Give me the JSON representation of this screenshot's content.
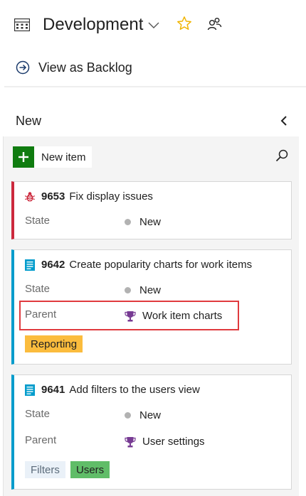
{
  "header": {
    "board_icon": "board-grid-icon",
    "title": "Development",
    "dropdown_icon": "chevron-down-icon",
    "favorite_icon": "star-icon",
    "team_icon": "people-icon"
  },
  "nav": {
    "backlog_icon": "arrow-circle-right-icon",
    "backlog_label": "View as Backlog"
  },
  "column": {
    "title": "New",
    "collapse_icon": "chevron-left-icon",
    "new_item_label": "New item",
    "search_icon": "search-icon"
  },
  "cards": [
    {
      "type": "bug",
      "icon": "bug-icon",
      "id": "9653",
      "title": "Fix display issues",
      "fields": [
        {
          "label": "State",
          "value": "New"
        }
      ],
      "tags": []
    },
    {
      "type": "product-backlog-item",
      "icon": "backlog-item-icon",
      "id": "9642",
      "title": "Create popularity charts for work items",
      "fields": [
        {
          "label": "State",
          "value": "New"
        },
        {
          "label": "Parent",
          "value": "Work item charts"
        }
      ],
      "tags": [
        "Reporting"
      ]
    },
    {
      "type": "product-backlog-item",
      "icon": "backlog-item-icon",
      "id": "9641",
      "title": "Add filters to the users view",
      "fields": [
        {
          "label": "State",
          "value": "New"
        },
        {
          "label": "Parent",
          "value": "User settings"
        }
      ],
      "tags": [
        "Filters",
        "Users"
      ]
    }
  ],
  "colors": {
    "accent_blue": "#009ccc",
    "bug_red": "#cc293d",
    "add_green": "#107c10",
    "highlight_red": "#e03a3e",
    "star_gold": "#f0b400",
    "trophy_purple": "#773b93"
  }
}
